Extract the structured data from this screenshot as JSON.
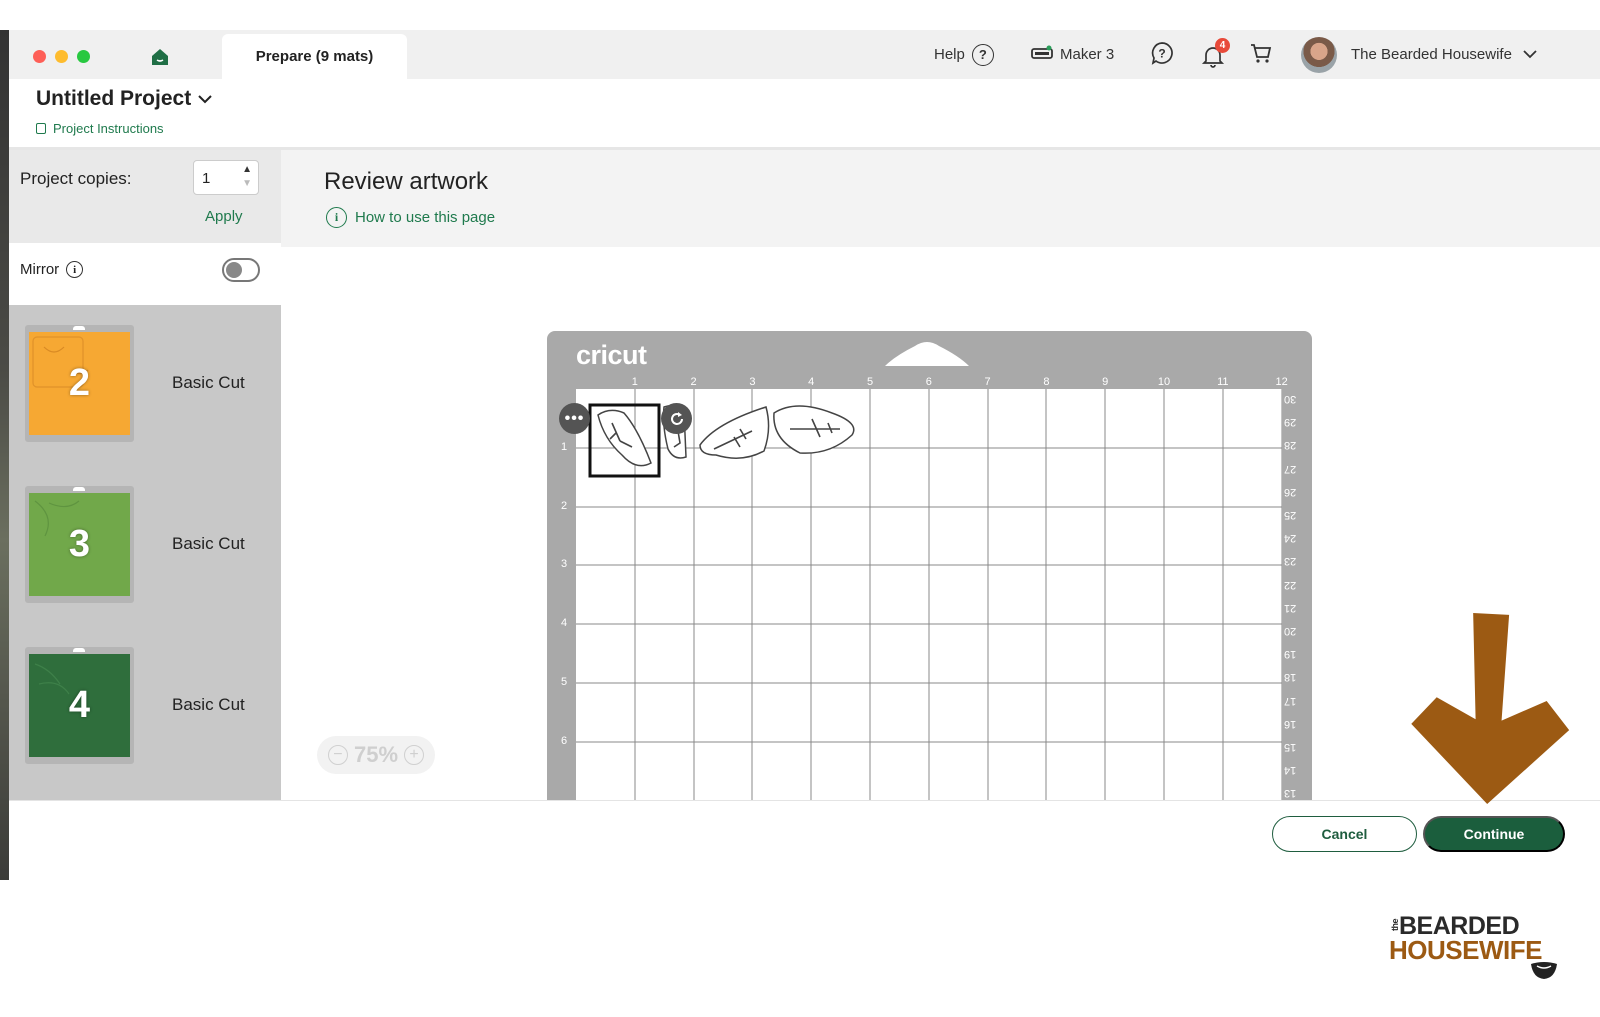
{
  "window": {
    "tab_label": "Prepare (9 mats)",
    "help_label": "Help",
    "help_icon": "?",
    "machine_label": "Maker 3",
    "notification_count": "4",
    "user_name": "The Bearded Housewife"
  },
  "project": {
    "title": "Untitled Project",
    "instructions_link": "Project Instructions"
  },
  "left_panel": {
    "copies_label": "Project copies:",
    "copies_value": "1",
    "apply_label": "Apply",
    "mirror_label": "Mirror",
    "mirror_on": false,
    "mats": [
      {
        "number": "2",
        "label": "Basic Cut",
        "color": "#f6a833"
      },
      {
        "number": "3",
        "label": "Basic Cut",
        "color": "#71a84a"
      },
      {
        "number": "4",
        "label": "Basic Cut",
        "color": "#2f6e3c"
      }
    ]
  },
  "main": {
    "title": "Review artwork",
    "howto_link": "How to use this page",
    "mat_brand": "cricut",
    "top_ruler": [
      "1",
      "2",
      "3",
      "4",
      "5",
      "6",
      "7",
      "8",
      "9",
      "10",
      "11",
      "12"
    ],
    "side_ruler": [
      "1",
      "2",
      "3",
      "4",
      "5",
      "6"
    ],
    "right_ruler": [
      "30",
      "29",
      "28",
      "27",
      "26",
      "25",
      "24",
      "23",
      "22",
      "21",
      "20",
      "19",
      "18",
      "17",
      "16",
      "15",
      "14",
      "13"
    ],
    "zoom_minus": "−",
    "zoom_level": "75%",
    "zoom_plus": "+",
    "more_icon": "•••"
  },
  "footer": {
    "cancel_label": "Cancel",
    "continue_label": "Continue"
  },
  "watermark": {
    "line1_prefix": "the",
    "line1": "BEARDED",
    "line2": "HOUSEWIFE"
  },
  "colors": {
    "accent_green": "#1b5e3d",
    "link_green": "#1f7a4d",
    "arrow_brown": "#9c5a13",
    "badge_red": "#e84a3a"
  }
}
